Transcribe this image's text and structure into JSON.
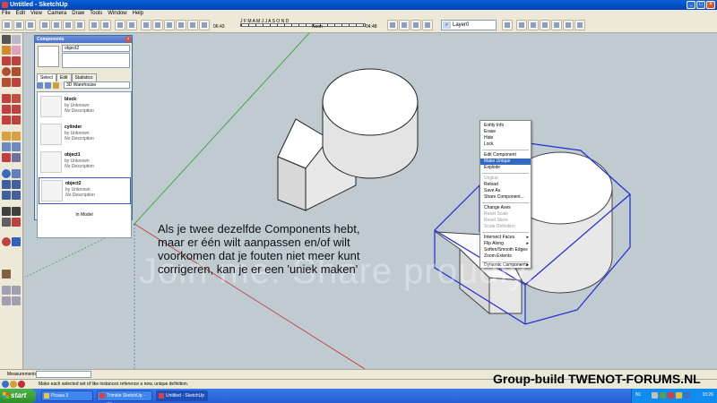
{
  "window": {
    "title": "Untitled - SketchUp"
  },
  "menu": [
    "File",
    "Edit",
    "View",
    "Camera",
    "Draw",
    "Tools",
    "Window",
    "Help"
  ],
  "toolbar": {
    "shadow_months": "J F M A M J J A S O N D",
    "shadow_time_start": "06:43",
    "shadow_time_end": "04:48",
    "shadow_time_mid": "Noon",
    "layer": "Layer0"
  },
  "components": {
    "title": "Components",
    "name_value": "object2",
    "tabs": [
      "Select",
      "Edit",
      "Statistics"
    ],
    "library": "3D Warehouse",
    "items": [
      {
        "name": "block",
        "by": "by Unknown",
        "desc": "No Description"
      },
      {
        "name": "cylinder",
        "by": "by Unknown",
        "desc": "No Description"
      },
      {
        "name": "object1",
        "by": "by Unknown",
        "desc": "No Description"
      },
      {
        "name": "object2",
        "by": "by Unknown",
        "desc": "No Description"
      }
    ],
    "footer": "In Model"
  },
  "context_menu": {
    "items": [
      {
        "label": "Entity Info",
        "state": "normal"
      },
      {
        "label": "Erase",
        "state": "normal"
      },
      {
        "label": "Hide",
        "state": "normal"
      },
      {
        "label": "Lock",
        "state": "normal"
      },
      {
        "label": "Edit Component",
        "state": "normal"
      },
      {
        "label": "Make Unique",
        "state": "highlight"
      },
      {
        "label": "Explode",
        "state": "normal"
      },
      {
        "label": "Unglue",
        "state": "disabled"
      },
      {
        "label": "Reload",
        "state": "normal"
      },
      {
        "label": "Save As",
        "state": "normal"
      },
      {
        "label": "Share Component...",
        "state": "normal"
      },
      {
        "label": "Change Axes",
        "state": "normal"
      },
      {
        "label": "Reset Scale",
        "state": "disabled"
      },
      {
        "label": "Reset Skew",
        "state": "disabled"
      },
      {
        "label": "Scale Definition",
        "state": "disabled"
      },
      {
        "label": "Intersect Faces",
        "state": "normal",
        "submenu": true
      },
      {
        "label": "Flip Along",
        "state": "normal",
        "submenu": true
      },
      {
        "label": "Soften/Smooth Edges",
        "state": "normal"
      },
      {
        "label": "Zoom Extents",
        "state": "normal"
      },
      {
        "label": "Dynamic Components",
        "state": "normal",
        "submenu": true
      }
    ]
  },
  "caption": {
    "lines": [
      "Als je twee dezelfde Components hebt,",
      "maar er één wilt aanpassen en/of wilt",
      "voorkomen dat je fouten niet meer kunt",
      "corrigeren, kan je er een 'uniek maken'"
    ]
  },
  "watermark": "Join me. Share proudly.",
  "measurements_label": "Measurements",
  "status_text": "Make each selected set of like instances reference a new, unique definition.",
  "forum_tag": "Group-build TWENOT-FORUMS.NL",
  "taskbar": {
    "start": "start",
    "tasks": [
      "Picasa 3",
      "Trimble SketchUp - Wi...",
      "Untitled - SketchUp"
    ],
    "lang": "NL",
    "clock": "10:26"
  },
  "colors": {
    "selection": "#1f2bd6",
    "highlight": "#316ac5",
    "axis_green": "#2a9a2a",
    "axis_red": "#c03030"
  }
}
